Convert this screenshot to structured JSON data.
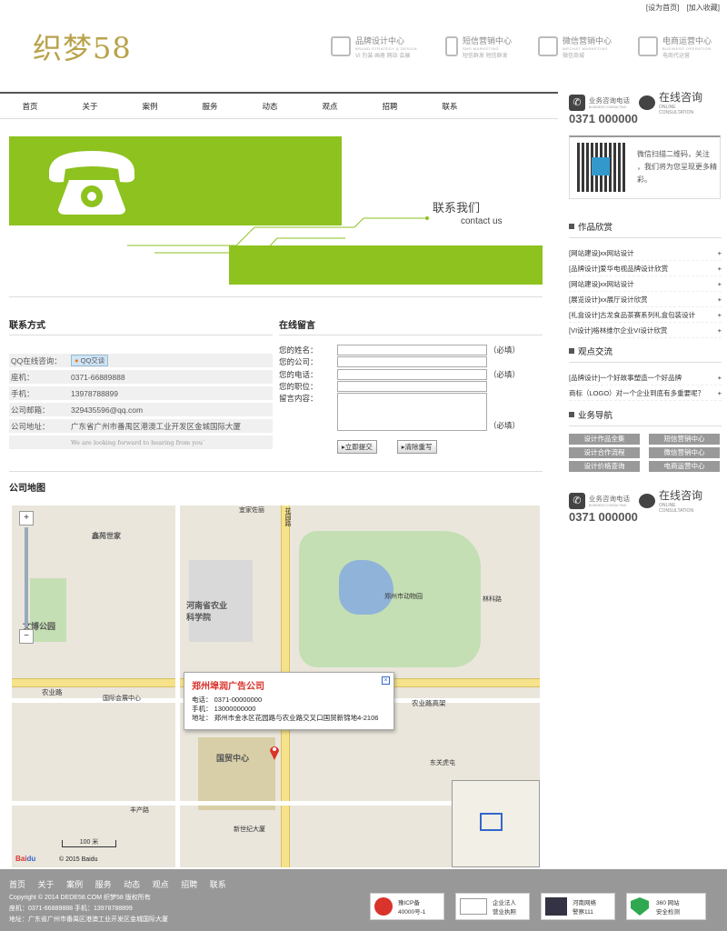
{
  "top_links": {
    "home": "[设为首页]",
    "fav": "[加入收藏]"
  },
  "logo": "织梦58",
  "services": [
    {
      "title": "品牌设计中心",
      "en": "BRAND STRATEGY & DESIGN",
      "sub": "VI  包装  画册  网站  会展"
    },
    {
      "title": "短信营销中心",
      "en": "SMS MARKETING",
      "sub": "短信群发  短信群发"
    },
    {
      "title": "微信营销中心",
      "en": "WECHAT MARKETING",
      "sub": "微信商城"
    },
    {
      "title": "电商运营中心",
      "en": "BUSINESS OPERATION",
      "sub": "电商代运营"
    }
  ],
  "nav": [
    "首页",
    "关于",
    "案例",
    "服务",
    "动态",
    "观点",
    "招聘",
    "联系"
  ],
  "banner": {
    "title": "联系我们",
    "subtitle": "contact us"
  },
  "contact": {
    "title": "联系方式",
    "rows": [
      {
        "label": "QQ在线咨询：",
        "value": "QQ交谈"
      },
      {
        "label": "座机：",
        "value": "0371-66889888"
      },
      {
        "label": "手机：",
        "value": "13978788899"
      },
      {
        "label": "公司邮箱：",
        "value": "329435596@qq.com"
      },
      {
        "label": "公司地址：",
        "value": "广东省广州市番禺区港澳工业开发区金城国际大厦"
      }
    ],
    "note": "We are looking forward to hearing from you`"
  },
  "message": {
    "title": "在线留言",
    "fields": [
      {
        "label": "您的姓名：",
        "req": "（必填）"
      },
      {
        "label": "您的公司：",
        "req": ""
      },
      {
        "label": "您的电话：",
        "req": "（必填）"
      },
      {
        "label": "您的职位：",
        "req": ""
      },
      {
        "label": "留言内容：",
        "req": "（必填）"
      }
    ],
    "submit": "立即提交",
    "reset": "清除重写"
  },
  "map": {
    "title": "公司地图",
    "popup_title": "郑州埠润广告公司",
    "popup_tel": "电话：  0371-00000000",
    "popup_mobile": "手机：  13000000000",
    "popup_addr": "地址：  郑州市金水区花园路与农业路交叉口国贸新锦地4-2106",
    "scale": "100 米",
    "copyright": "© 2015 Baidu",
    "labels": {
      "a": "鑫苑世家",
      "b": "河南省农业科学院",
      "c": "文博公园",
      "d": "农业路",
      "e": "国贸中心",
      "f": "花园路",
      "g": "郑州市动物园",
      "h": "林科路",
      "i": "丰产路",
      "j": "农业路高架",
      "k": "国际会展中心",
      "l": "宜家佐丽",
      "m": "东关虎屯",
      "n": "新世纪大厦"
    }
  },
  "sidebar": {
    "hotline_label": "业务咨询电话",
    "hotline_en": "BUSINESS CONSULTING",
    "hotline_num": "0371 000000",
    "online": "在线咨询",
    "online_en": "ONLINE CONSULTATION",
    "qr_text": "微信扫描二维码，关注          ，我们将为您呈现更多精彩。",
    "works_title": "作品欣赏",
    "works": [
      "[网站建设]xx网站设计",
      "[品牌设计]爱华电视品牌设计欣赏",
      "[网站建设]xx网站设计",
      "[展览设计]xx展厅设计欣赏",
      "[礼盒设计]古龙食品茶赛系列礼盒包装设计",
      "[VI设计]格林维尔企业VI设计欣赏"
    ],
    "views_title": "观点交流",
    "views": [
      "[品牌设计]一个好故事塑造一个好品牌",
      "商标（LOGO）对一个企业到底有多重要呢？"
    ],
    "biz_title": "业务导航",
    "biz": [
      "设计作品全集",
      "短信营销中心",
      "设计合作流程",
      "微信营销中心",
      "设计价格查询",
      "电商运营中心"
    ]
  },
  "footer": {
    "nav": [
      "首页",
      "关于",
      "案例",
      "服务",
      "动态",
      "观点",
      "招聘",
      "联系"
    ],
    "copyright": "Copyright © 2014 DEDE58.COM 织梦58 版权所有",
    "phones": "座机：0371-66889888  手机：13978788899",
    "addr": "地址：广东省广州市番禺区港澳工业开发区金城国际大厦",
    "badges": [
      {
        "t1": "豫ICP备",
        "t2": "40000号-1"
      },
      {
        "t1": "企业法人",
        "t2": "营业执照"
      },
      {
        "t1": "河南网络",
        "t2": "警察111"
      },
      {
        "t1": "360 网站",
        "t2": "安全检测"
      }
    ]
  },
  "colors": {
    "brand_green": "#8dc21f",
    "logo_gold": "#b9a24a",
    "popup_red": "#d9332b",
    "footer_gray": "#989898"
  }
}
